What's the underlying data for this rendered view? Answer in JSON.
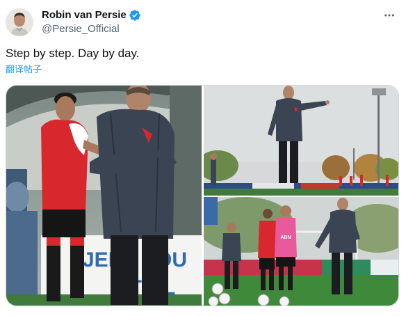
{
  "author": {
    "display_name": "Robin van Persie",
    "handle": "@Persie_Official",
    "verified": true,
    "avatar_icon": "profile-avatar"
  },
  "tweet": {
    "text": "Step by step. Day by day.",
    "translate_label": "翻译帖子"
  },
  "media": {
    "photos": [
      {
        "icon": "photo-coach-talking-to-player"
      },
      {
        "icon": "photo-coach-on-pitch-pointing"
      },
      {
        "icon": "photo-coach-with-young-players"
      }
    ]
  },
  "colors": {
    "accent": "#1d9bf0",
    "text": "#0f1419",
    "secondary_text": "#536471",
    "border": "#cfd9de"
  },
  "icons": {
    "more": "more-options-icon",
    "verified": "verified-badge-icon"
  }
}
